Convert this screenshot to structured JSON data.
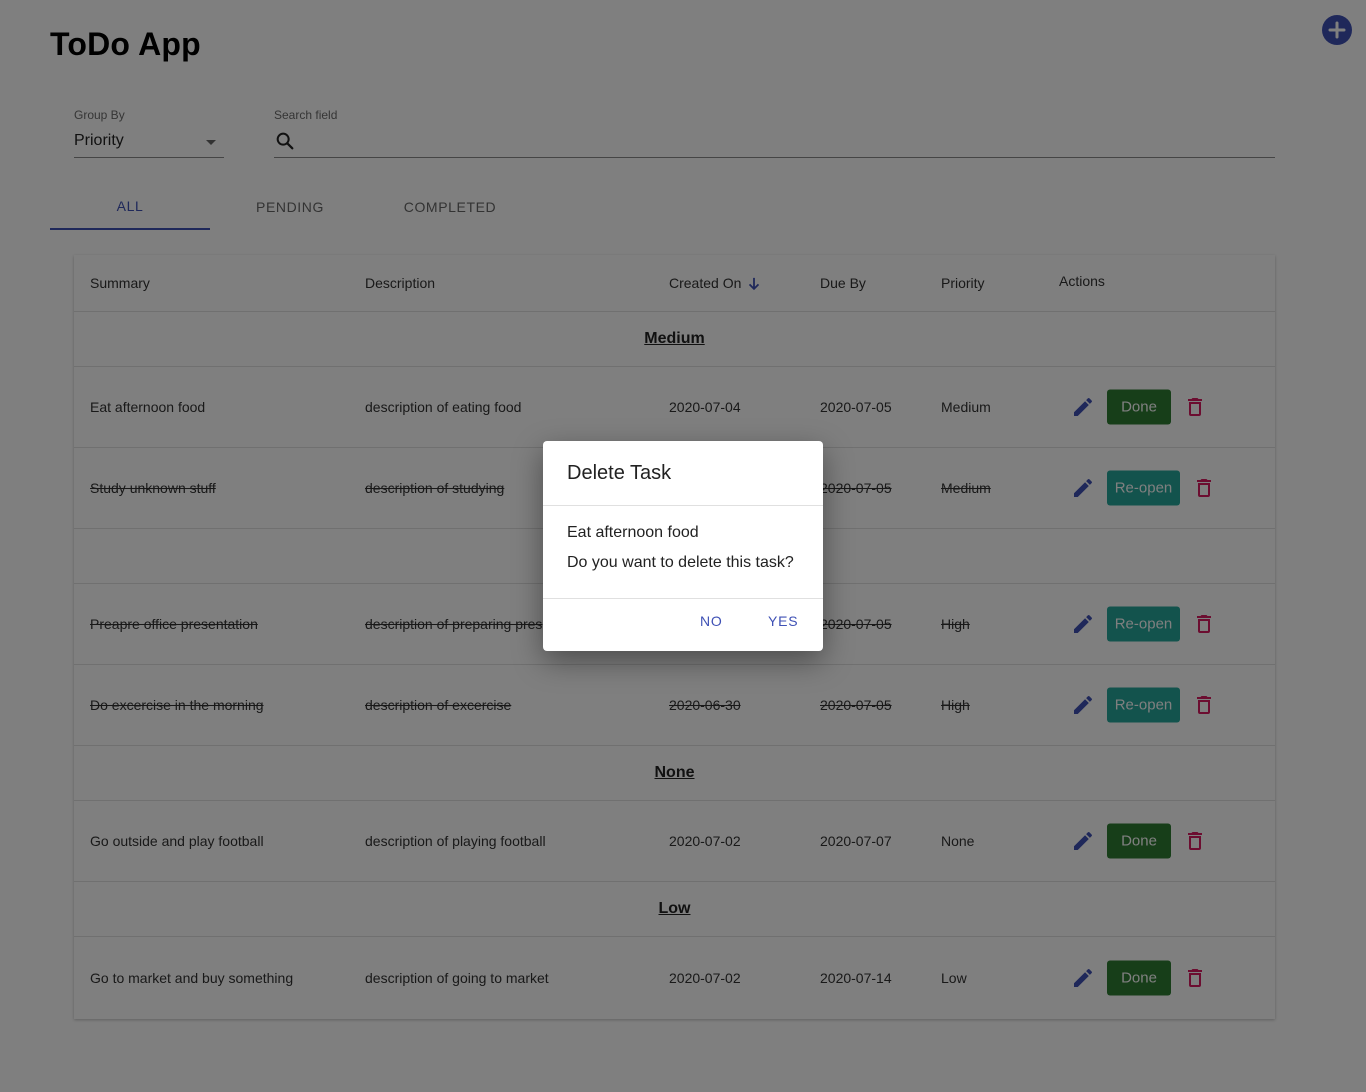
{
  "app": {
    "title": "ToDo App"
  },
  "colors": {
    "accent": "#3f51b5",
    "done_button": "#2e7d32",
    "reopen_button": "#26a69a",
    "delete_icon": "#d81b60"
  },
  "filters": {
    "group_by_label": "Group By",
    "group_by_value": "Priority",
    "search_label": "Search field",
    "search_value": ""
  },
  "tabs": [
    {
      "label": "ALL",
      "active": true
    },
    {
      "label": "PENDING",
      "active": false
    },
    {
      "label": "COMPLETED",
      "active": false
    }
  ],
  "table": {
    "columns": [
      "Summary",
      "Description",
      "Created On",
      "Due By",
      "Priority",
      "Actions"
    ],
    "groups": [
      {
        "label": "Medium",
        "rows": [
          {
            "summary": "Eat afternoon food",
            "description": "description of eating food",
            "created": "2020-07-04",
            "due": "2020-07-05",
            "priority": "Medium",
            "action": "Done",
            "completed": false
          },
          {
            "summary": "Study unknown stuff",
            "description": "description of studying",
            "created": "",
            "due": "2020-07-05",
            "priority": "Medium",
            "action": "Re-open",
            "completed": true
          }
        ]
      },
      {
        "label": "",
        "rows": [
          {
            "summary": "Preapre office presentation",
            "description": "description of preparing pres",
            "created": "",
            "due": "2020-07-05",
            "priority": "High",
            "action": "Re-open",
            "completed": true
          },
          {
            "summary": "Do excercise in the morning",
            "description": "description of excercise",
            "created": "2020-06-30",
            "due": "2020-07-05",
            "priority": "High",
            "action": "Re-open",
            "completed": true
          }
        ]
      },
      {
        "label": "None",
        "rows": [
          {
            "summary": "Go outside and play football",
            "description": "description of playing football",
            "created": "2020-07-02",
            "due": "2020-07-07",
            "priority": "None",
            "action": "Done",
            "completed": false
          }
        ]
      },
      {
        "label": "Low",
        "rows": [
          {
            "summary": "Go to market and buy something",
            "description": "description of going to market",
            "created": "2020-07-02",
            "due": "2020-07-14",
            "priority": "Low",
            "action": "Done",
            "completed": false
          }
        ]
      }
    ]
  },
  "dialog": {
    "title": "Delete Task",
    "task": "Eat afternoon food",
    "question": "Do you want to delete this task?",
    "no_label": "NO",
    "yes_label": "YES"
  }
}
